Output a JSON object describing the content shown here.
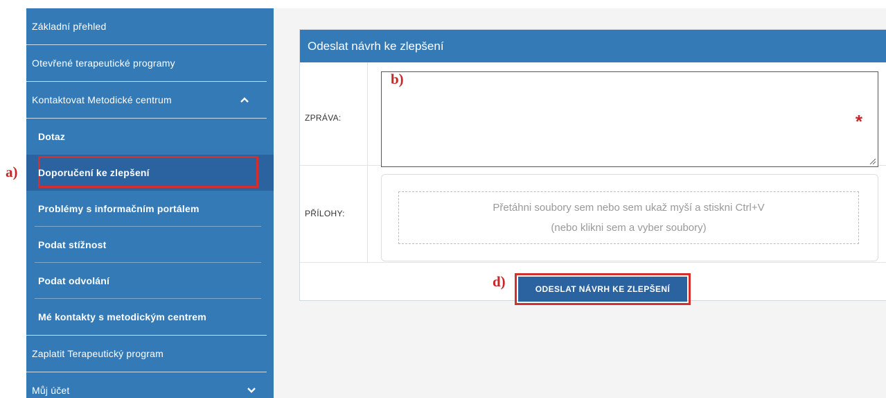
{
  "sidebar": {
    "items": [
      {
        "label": "Základní přehled"
      },
      {
        "label": "Otevřené terapeutické programy"
      },
      {
        "label": "Kontaktovat Metodické centrum",
        "icon": "chevron-up-icon"
      },
      {
        "label": "Zaplatit Terapeutický program"
      },
      {
        "label": "Můj účet",
        "icon": "chevron-down-icon"
      }
    ],
    "subitems": [
      {
        "label": "Dotaz"
      },
      {
        "label": "Doporučení ke zlepšení",
        "active": true
      },
      {
        "label": "Problémy s informačním portálem"
      },
      {
        "label": "Podat stížnost"
      },
      {
        "label": "Podat odvolání"
      },
      {
        "label": "Mé kontakty s metodickým centrem"
      }
    ]
  },
  "form": {
    "title": "Odeslat návrh ke zlepšení",
    "message_label": "ZPRÁVA:",
    "message_value": "",
    "required_mark": "*",
    "attachments_label": "PŘÍLOHY:",
    "dropzone_line1": "Přetáhni soubory sem nebo sem ukaž myší a stiskni Ctrl+V",
    "dropzone_line2": "(nebo klikni sem a vyber soubory)",
    "submit_label": "ODESLAT NÁVRH KE ZLEPŠENÍ"
  },
  "annotations": {
    "a": "a)",
    "b": "b)",
    "d": "d)"
  },
  "colors": {
    "primary": "#337ab7",
    "active": "#2a63a0",
    "annotation": "#d32f2f"
  }
}
